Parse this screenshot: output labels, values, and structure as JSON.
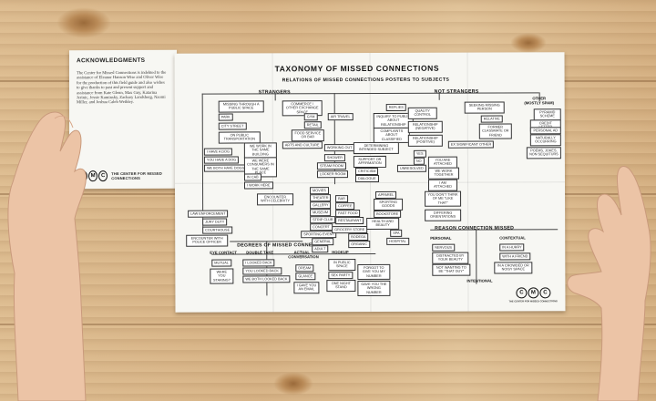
{
  "acknowledgments": {
    "title": "ACKNOWLEDGMENTS",
    "body": "The Center for Missed Connections is indebted to the assistance of Eleanor Hanson Wise and Oliver Wise for the production of this field guide and also wishes to give thanks to past and present support and assistance from Kate Glenn, Max Guy, Katarina Jerinic, Jessie Kaminsky, Zachary Landsberg, Naomi Miller, and Joshua Caleb Weibley.",
    "logo_letters": [
      "C",
      "M",
      "C"
    ],
    "logo_text": "THE CENTER FOR MISSED CONNECTIONS"
  },
  "map": {
    "title": "TAXONOMY OF MISSED CONNECTIONS",
    "subtitle": "RELATIONS OF MISSED CONNECTIONS POSTERS TO SUBJECTS",
    "sections": {
      "strangers": "STRANGERS",
      "not_strangers": "NOT STRANGERS",
      "other": "OTHER (MOSTLY SPAM)",
      "degrees": "DEGREES OF MISSED CONNECTION",
      "reason": "REASON CONNECTION MISSED"
    },
    "column_heads": {
      "eye_contact": "EYE CONTACT",
      "double_take": "DOUBLE TAKE",
      "actual_conversation": "ACTUAL CONVERSATION",
      "hookup": "HOOKUP",
      "personal": "PERSONAL",
      "contextual": "CONTEXTUAL",
      "intentional": "INTENTIONAL"
    },
    "boxes": {
      "missing_through": "MISSING THROUGH A PUBLIC SPACE",
      "park": "PARK",
      "city_street": "CITY STREET",
      "public_transport": "ON PUBLIC TRANSPORTATION",
      "have_a_dog": "I HAVE A DOG",
      "you_have_a_dog": "YOU HAVE A DOG",
      "both_have_dogs": "WE BOTH HAVE DOGS",
      "same_building": "WE WORK IN THE SAME BUILDING",
      "consumers": "WE WERE CONSUMERS IN THE SAME PLACE",
      "in_cab": "IN CAB",
      "i_work_here": "I WORK HERE",
      "commerce": "COMMERCE / OTHER EXCHANGE SPACE",
      "gym": "GYM",
      "retail": "RETAIL",
      "food_service": "FOOD SERVICE OR BAR",
      "arts_culture": "ARTS AND CULTURE",
      "air_travel": "AIR TRAVEL",
      "working_out": "WORKING OUT",
      "shower": "SHOWER",
      "steam_room": "STEAM ROOM",
      "locker_room": "LOCKER ROOM",
      "encounter_celebrity": "ENCOUNTER WITH CELEBRITY",
      "law_enforcement": "LAW ENFORCEMENT",
      "jury_duty": "JURY DUTY",
      "courthouse": "COURTHOUSE",
      "police_officer": "ENCOUNTER WITH POLICE OFFICER",
      "movies": "MOVIES",
      "theater": "THEATER",
      "gallery": "GALLERY",
      "museum": "MUSEUM",
      "strip_club": "STRIP CLUB",
      "concert": "CONCERT",
      "sporting_event": "SPORTING EVENT",
      "bar": "BAR",
      "coffee": "COFFEE",
      "fast_food": "FAST FOOD",
      "restaurant": "RESTAURANT",
      "grocery_store": "GROCERY STORE",
      "bodega": "BODEGA",
      "organic": "ORGANIC",
      "general": "GENERAL",
      "adult": "ADULT",
      "apparel": "APPAREL",
      "sporting_goods": "SPORTING GOODS",
      "bookstore": "BOOKSTORE",
      "health_beauty": "HEALTH AND BEAUTY",
      "spa": "SPA",
      "hospital": "HOSPITAL",
      "replies": "REPLIES",
      "inquiry": "INQUIRY TO PUBLIC ABOUT RELATIONSHIP",
      "complaints": "COMPLAINTS ABOUT CLASSIFIED",
      "determining": "DETERMINING INTENDED SUBJECT",
      "support": "SUPPORT OR AFFIRMATION",
      "criticism": "CRITICISM",
      "dialogue": "DIALOGUE",
      "quality_control": "QUALITY CONTROL",
      "relationship_neg": "RELATIONSHIP (NEGATIVE)",
      "relationship_pos": "RELATIONSHIP (POSITIVE)",
      "yes": "YES",
      "no": "NO",
      "unresolved": "UNRESOLVED",
      "looking_missing": "SEEKING MISSING PERSON",
      "relative": "RELATIVE",
      "former_classmate": "FORMER CLASSMATE OR FRIEND",
      "ex_significant": "EX SIGNIFICANT OTHER",
      "attached": "YOU ARE ATTACHED",
      "we_work_together": "WE WORK TOGETHER",
      "i_am_attached": "I AM ATTACHED",
      "dont_like_that": "YOU DON'T THINK OF ME \"LIKE THAT\"",
      "differing_orientations": "DIFFERING ORIENTATIONS",
      "pyramid": "PYRAMID SCHEME",
      "credit_letter": "CREDIT LETTER",
      "personal_ad": "PERSONAL AD",
      "naturally": "NATURALLY OCCURRING",
      "poems": "POEMS, JOKES, NON SEQUITURS",
      "nervous": "NERVOUS",
      "distracted": "DISTRACTED BY YOUR BEAUTY",
      "not_wanting": "NOT WANTING TO BE \"THAT GUY\"",
      "in_a_hurry": "IN A HURRY",
      "with_a_friend": "WITH A FRIEND",
      "crowded": "IN A CROWDED OR NOISY SPACE",
      "mutual": "MUTUAL",
      "were_you_staring": "WERE YOU STARING?",
      "looked_back": "I LOOKED BACK",
      "you_looked_back": "YOU LOOKED BACK",
      "both_looked_back": "WE BOTH LOOKED BACK",
      "dream": "DREAM",
      "glance": "GLANCE",
      "i_gave_email": "I GAVE YOU AN EMAIL",
      "in_public_space": "IN PUBLIC SPACE",
      "sex_party": "SEX PARTY",
      "one_night_stand": "ONE NIGHT STAND",
      "forgot_number": "FORGOT TO GIVE YOU MY NUMBER",
      "wrong_number": "GAVE YOU THE WRONG NUMBER"
    },
    "logo_letters": [
      "C",
      "M",
      "C"
    ],
    "footer_text": "THE CENTER FOR MISSED CONNECTIONS"
  }
}
